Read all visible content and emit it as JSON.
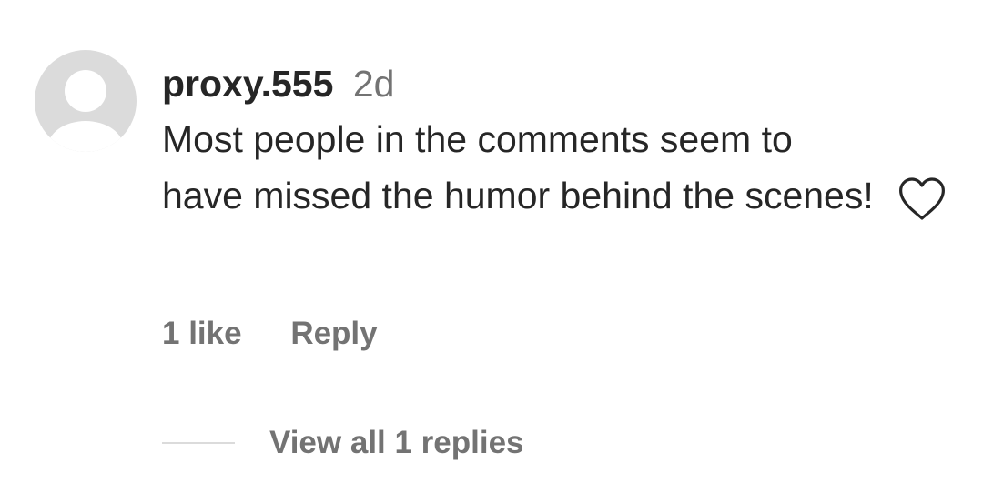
{
  "comment": {
    "username": "proxy.555",
    "timestamp": "2d",
    "text": "Most people in the comments seem to have missed the humor behind the scenes!",
    "likes_label": "1 like",
    "reply_label": "Reply",
    "view_replies_label": "View all 1 replies",
    "avatar_icon": "default-avatar-icon",
    "like_icon": "heart-outline-icon"
  },
  "colors": {
    "text_primary": "#262626",
    "text_secondary": "#737373",
    "divider": "#dbdbdb",
    "avatar_bg": "#dbdbdb"
  }
}
